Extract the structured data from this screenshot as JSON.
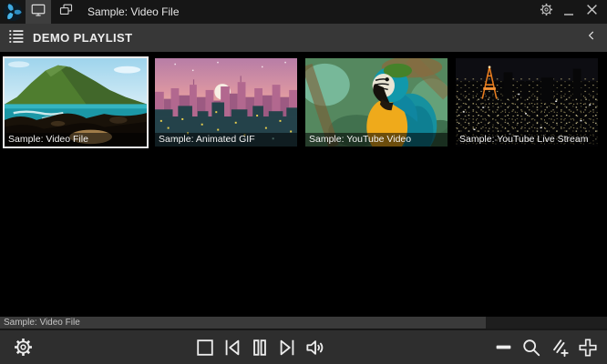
{
  "titlebar": {
    "title": "Sample: Video File",
    "logo": "app-logo-triskelion",
    "tabs": [
      {
        "icon": "monitor-icon",
        "selected": true
      },
      {
        "icon": "duplicate-windows-icon",
        "selected": false
      }
    ],
    "controls": {
      "settings": "gear-icon",
      "minimize": "minimize-icon",
      "close": "close-icon"
    }
  },
  "playlist_header": {
    "title": "DEMO PLAYLIST",
    "menu_icon": "playlist-list-icon",
    "collapse_icon": "chevron-left-icon"
  },
  "playlist_items": [
    {
      "label": "Sample: Video File",
      "selected": true,
      "thumbnail": "tropical-beach"
    },
    {
      "label": "Sample: Animated GIF",
      "selected": false,
      "thumbnail": "pixel-city-sunset"
    },
    {
      "label": "Sample: YouTube Video",
      "selected": false,
      "thumbnail": "macaw-parrot"
    },
    {
      "label": "Sample: YouTube Live Stream",
      "selected": false,
      "thumbnail": "tokyo-night-skyline"
    }
  ],
  "status_bar": {
    "label": "Sample: Video File",
    "progress_percent": 80
  },
  "toolbar": {
    "left": [
      "gear-icon"
    ],
    "playback": [
      "stop-icon",
      "previous-icon",
      "pause-icon",
      "next-icon",
      "volume-icon"
    ],
    "right": [
      "minus-icon",
      "magnifier-icon",
      "wand-plus-icon",
      "plus-icon"
    ]
  },
  "colors": {
    "accent_blue": "#3fa9e0",
    "titlebar_bg": "#161616",
    "header_bg": "#373737",
    "toolbar_bg": "#2e2e2e",
    "status_fill": "#3a3a3a",
    "status_track": "#1e1e1e",
    "selection_border": "#ececec",
    "main_bg": "#000000"
  }
}
